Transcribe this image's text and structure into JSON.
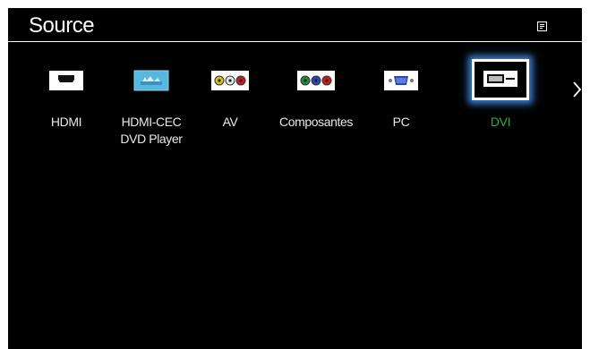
{
  "screen": {
    "title": "Source",
    "tools_icon": "tools-menu-icon"
  },
  "sources": [
    {
      "label": "HDMI",
      "icon": "hdmi-port-icon",
      "selected": false
    },
    {
      "label": "HDMI-CEC\nDVD Player",
      "icon": "anynet-cec-icon",
      "selected": false
    },
    {
      "label": "AV",
      "icon": "av-rca-connector-icon",
      "selected": false
    },
    {
      "label": "Composantes",
      "icon": "component-rca-connector-icon",
      "selected": false
    },
    {
      "label": "PC",
      "icon": "vga-port-icon",
      "selected": false
    },
    {
      "label": "DVI",
      "icon": "dvi-port-icon",
      "selected": true
    }
  ],
  "navigation": {
    "next_icon": "chevron-right-icon"
  },
  "colors": {
    "background": "#000000",
    "selected_text": "#3ca636",
    "focus_glow": "#3a78c2",
    "tile": "#ffffff"
  }
}
